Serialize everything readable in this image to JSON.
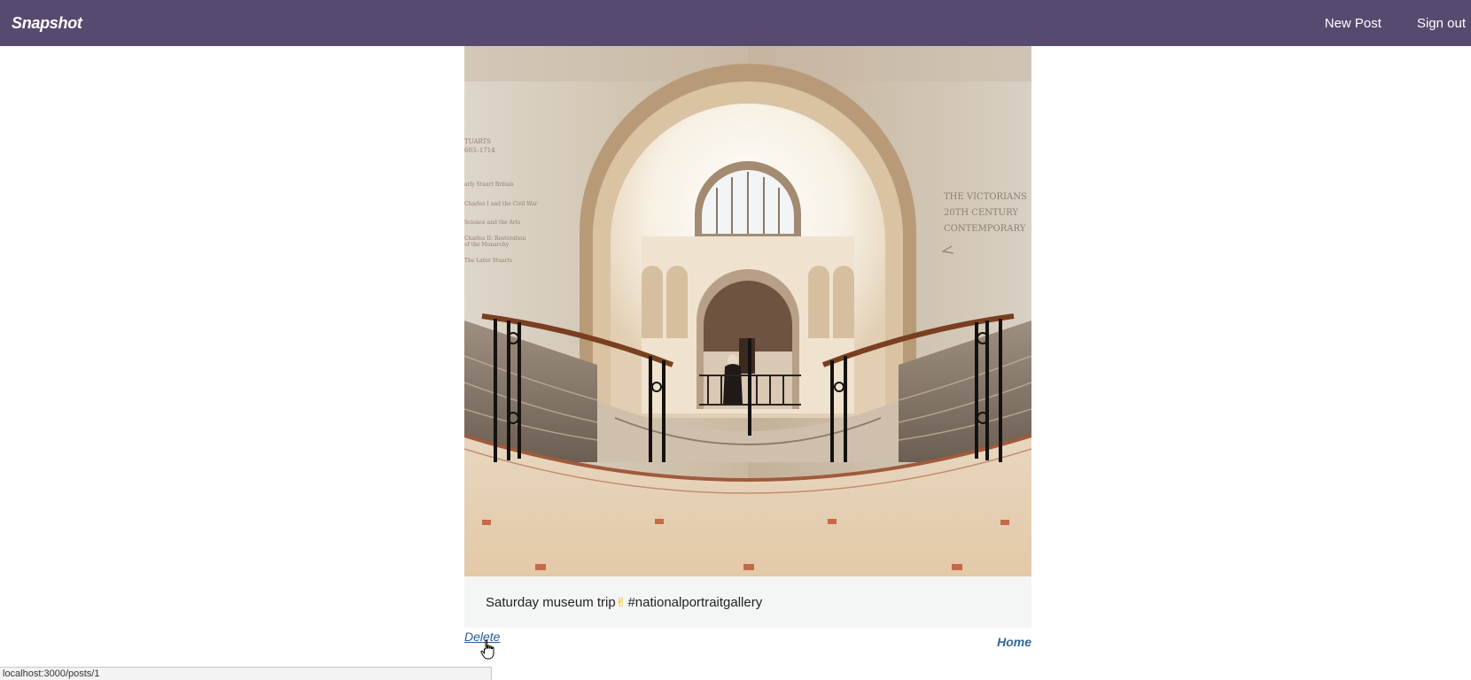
{
  "navbar": {
    "brand": "Snapshot",
    "links": [
      {
        "label": "New Post"
      },
      {
        "label": "Sign out"
      }
    ],
    "background": "#574a6f"
  },
  "post": {
    "caption_prefix": "Saturday museum trip",
    "caption_emoji": "✌",
    "caption_hashtag": "#nationalportraitgallery",
    "wall_text_left": [
      "TUARTS",
      "603–1714",
      "arly Stuart Britain",
      "Charles I and the Civil War",
      "Science and the Arts",
      "Charles II: Restoration",
      "of the Monarchy",
      "The Later Stuarts"
    ],
    "wall_text_right": [
      "THE VICTORIANS",
      "20TH CENTURY",
      "CONTEMPORARY"
    ]
  },
  "actions": {
    "delete_label": "Delete",
    "home_label": "Home"
  },
  "status_bar": {
    "url": "localhost:3000/posts/1"
  },
  "colors": {
    "link": "#336699",
    "caption_bg": "#f4f6f6"
  }
}
